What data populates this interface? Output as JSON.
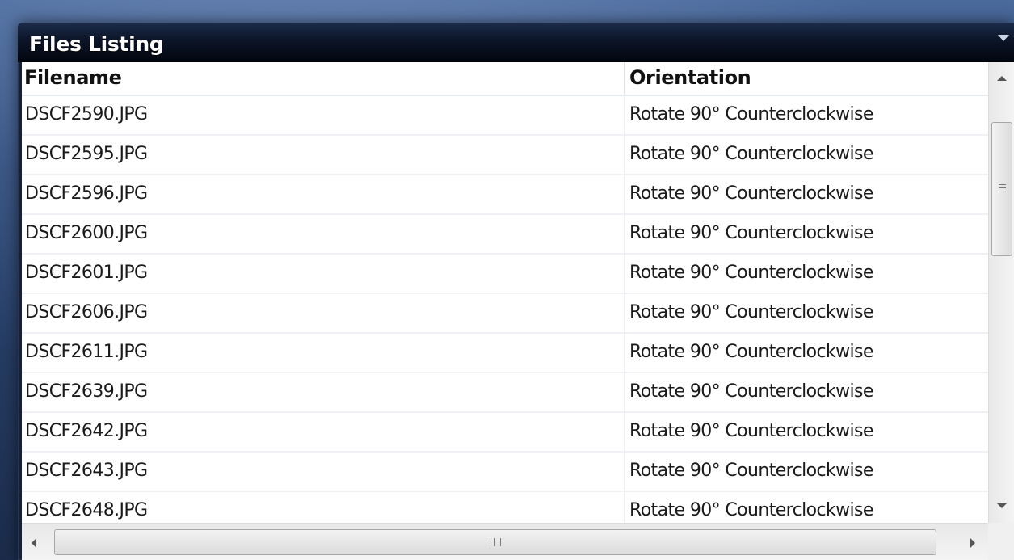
{
  "panel": {
    "title": "Files Listing",
    "menu_icon": "chevron-down-icon"
  },
  "table": {
    "columns": [
      "Filename",
      "Orientation"
    ],
    "rows": [
      {
        "filename": "DSCF2590.JPG",
        "orientation": "Rotate 90° Counterclockwise"
      },
      {
        "filename": "DSCF2595.JPG",
        "orientation": "Rotate 90° Counterclockwise"
      },
      {
        "filename": "DSCF2596.JPG",
        "orientation": "Rotate 90° Counterclockwise"
      },
      {
        "filename": "DSCF2600.JPG",
        "orientation": "Rotate 90° Counterclockwise"
      },
      {
        "filename": "DSCF2601.JPG",
        "orientation": "Rotate 90° Counterclockwise"
      },
      {
        "filename": "DSCF2606.JPG",
        "orientation": "Rotate 90° Counterclockwise"
      },
      {
        "filename": "DSCF2611.JPG",
        "orientation": "Rotate 90° Counterclockwise"
      },
      {
        "filename": "DSCF2639.JPG",
        "orientation": "Rotate 90° Counterclockwise"
      },
      {
        "filename": "DSCF2642.JPG",
        "orientation": "Rotate 90° Counterclockwise"
      },
      {
        "filename": "DSCF2643.JPG",
        "orientation": "Rotate 90° Counterclockwise"
      },
      {
        "filename": "DSCF2648.JPG",
        "orientation": "Rotate 90° Counterclockwise"
      }
    ]
  },
  "colors": {
    "titlebar": "#0c1528",
    "background": "#2e4a78",
    "grid_background": "#ffffff"
  }
}
